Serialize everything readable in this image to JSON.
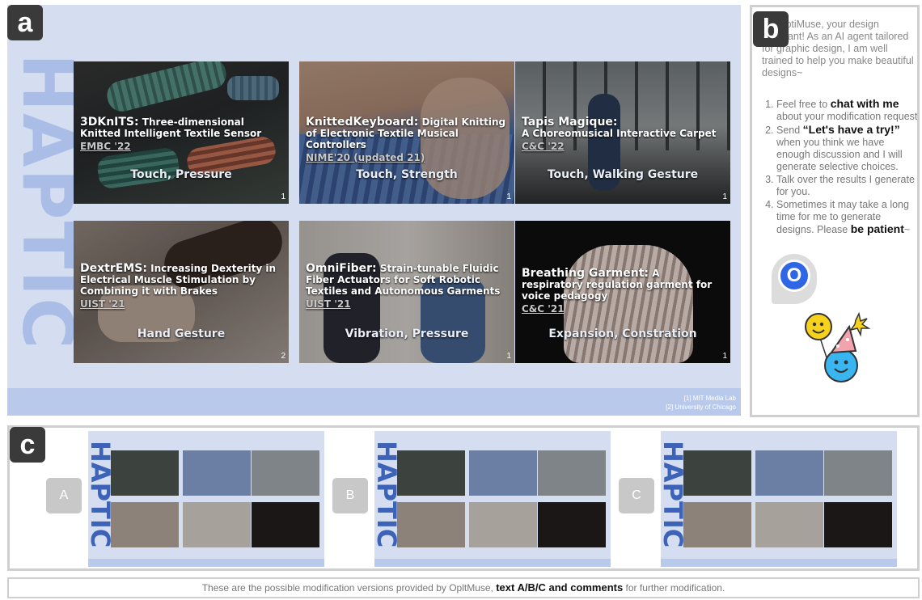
{
  "panel_a": {
    "tag": "a",
    "vertical_title": "HAPTIC",
    "tiles": [
      {
        "title_bold": "3DKnITS:",
        "title_rest": " Three-dimensional Knitted Intelligent Textile Sensor",
        "venue": "EMBC '22",
        "category": "Touch, Pressure",
        "footnote": "1"
      },
      {
        "title_bold": "KnittedKeyboard:",
        "title_rest": " Digital Knitting of Electronic Textile Musical Controllers",
        "venue": "NIME'20 (updated 21)",
        "category": "Touch, Strength",
        "footnote": "1"
      },
      {
        "title_bold": "Tapis Magique:",
        "title_rest": " A Choreomusical Interactive Carpet",
        "venue": "C&C '22",
        "category": "Touch,  Walking Gesture",
        "footnote": "1"
      },
      {
        "title_bold": "DextrEMS:",
        "title_rest": " Increasing Dexterity in Electrical Muscle Stimulation by Combining it with Brakes",
        "venue": "UIST '21",
        "category": "Hand Gesture",
        "footnote": "2"
      },
      {
        "title_bold": "OmniFiber:",
        "title_rest": " Strain-tunable Fluidic Fiber Actuators for Soft Robotic Textiles and Autonomous Garments",
        "venue": "UIST '21",
        "category": "Vibration, Pressure",
        "footnote": "1"
      },
      {
        "title_bold": "Breathing Garment:",
        "title_rest": " A respiratory regulation garment for voice  pedagogy",
        "venue": "C&C '21",
        "category": "Expansion, Constration",
        "footnote": "1"
      }
    ],
    "footer_lines": [
      "[1] MIT Media Lab",
      "[2] University of Chicago"
    ]
  },
  "panel_b": {
    "tag": "b",
    "intro": "I'm OptiMuse, your design assistant! As an AI agent tailored for graphic design, I am well trained to help you make beautiful designs~",
    "steps": [
      {
        "pre": "Feel free to ",
        "bold": "chat with me",
        "post": " about your modification request!"
      },
      {
        "pre": "Send ",
        "bold": "“Let's have a try!”",
        "post": " when you think we have enough discussion and I will generate selective choices."
      },
      {
        "pre": "Talk over the results I generate for you.",
        "bold": "",
        "post": ""
      },
      {
        "pre": "Sometimes it may take a long time for me to generate designs. Please ",
        "bold": "be patient",
        "post": "~"
      }
    ],
    "avatar_letter": "O"
  },
  "panel_c": {
    "tag": "c",
    "options": [
      "A",
      "B",
      "C"
    ],
    "thumb_title": "HAPTIC"
  },
  "caption": {
    "pre": "These are the possible modification versions provided by OpltMuse, ",
    "bold": "text A/B/C and comments",
    "post": " for further modification."
  },
  "colors": {
    "panel_bg": "#d5def1",
    "footer_bg": "#b8c9ec",
    "haptic_light": "#a9bde6",
    "haptic_dark": "#3d63b8",
    "avatar_blue": "#2f66e6"
  }
}
